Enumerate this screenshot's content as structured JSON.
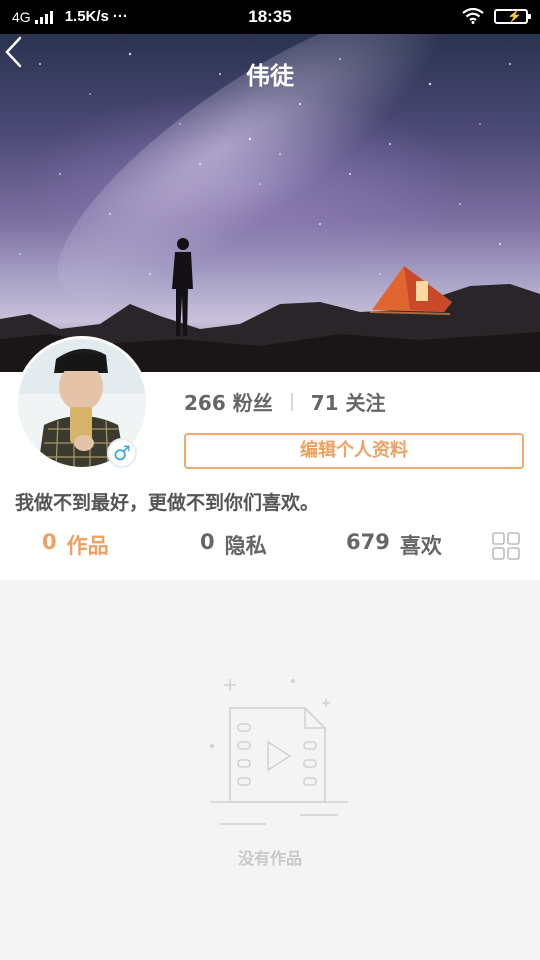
{
  "status_bar": {
    "network": "4G",
    "speed": "1.5K/s",
    "more": "···",
    "time": "18:35"
  },
  "header": {
    "title": "伟徒"
  },
  "profile": {
    "fans_count": "266",
    "fans_label": "粉丝",
    "follow_count": "71",
    "follow_label": "关注",
    "edit_button": "编辑个人资料",
    "bio": "我做不到最好，更做不到你们喜欢。",
    "gender_symbol": "♂"
  },
  "tabs": [
    {
      "count": "0",
      "label": "作品",
      "active": true
    },
    {
      "count": "0",
      "label": "隐私",
      "active": false
    },
    {
      "count": "679",
      "label": "喜欢",
      "active": false
    }
  ],
  "empty_state": {
    "text": "没有作品"
  },
  "colors": {
    "accent": "#f0a060",
    "gender": "#3aa7e6"
  }
}
